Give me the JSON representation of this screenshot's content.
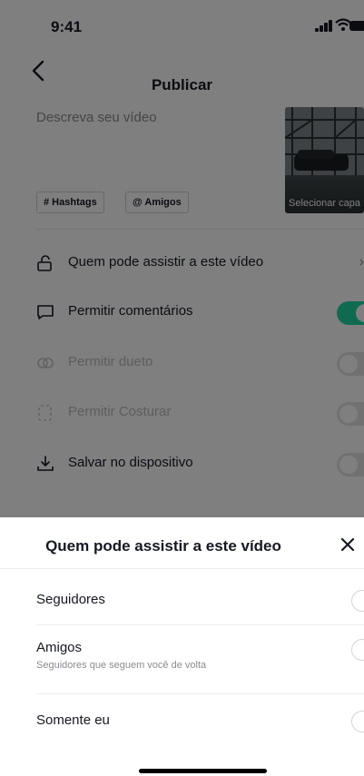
{
  "status_bar": {
    "time": "9:41"
  },
  "header": {
    "title": "Publicar"
  },
  "composer": {
    "description_placeholder": "Descreva seu vídeo",
    "cover_label": "Selecionar capa",
    "chips": [
      "# Hashtags",
      "@ Amigos"
    ]
  },
  "settings": {
    "who_can_watch": "Quem pode assistir a este vídeo",
    "allow_comments": {
      "label": "Permitir comentários",
      "on": true
    },
    "allow_duet": {
      "label": "Permitir dueto",
      "on": false
    },
    "allow_stitch": {
      "label": "Permitir Costurar",
      "on": false
    },
    "save_to_device": {
      "label": "Salvar no dispositivo",
      "on": false
    }
  },
  "sheet": {
    "title": "Quem pode assistir a este vídeo",
    "close": "×",
    "options": [
      {
        "label": "Seguidores",
        "sub": ""
      },
      {
        "label": "Amigos",
        "sub": "Seguidores que seguem você de volta"
      },
      {
        "label": "Somente eu",
        "sub": ""
      }
    ]
  },
  "colors": {
    "accent": "#20d5a1",
    "text": "#161823",
    "muted": "#8a8b91"
  }
}
